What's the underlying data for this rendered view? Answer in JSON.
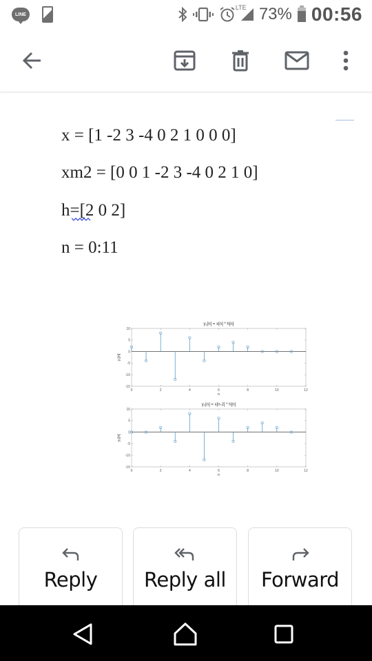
{
  "status_bar": {
    "left_icons": [
      "line-app-icon",
      "phone-screenshot-icon"
    ],
    "line_label": "LINE",
    "right_icons": [
      "bluetooth-icon",
      "vibrate-icon",
      "alarm-icon",
      "lte-signal-icon",
      "battery-icon"
    ],
    "network": "LTE",
    "battery_percent": "73%",
    "time": "00:56"
  },
  "toolbar": {
    "back_icon": "arrow-back-icon",
    "actions": [
      "archive-icon",
      "delete-icon",
      "mark-unread-icon",
      "more-vert-icon"
    ]
  },
  "message": {
    "lines": [
      "x = [1 -2 3 -4 0 2 1 0 0 0]",
      "xm2 = [0 0 1 -2 3 -4 0 2 1 0]",
      "h=[2 0 2]",
      "n = 0:11"
    ]
  },
  "chart_data": [
    {
      "type": "stem",
      "title": "y₁[n] = x[n] * h[n]",
      "xlabel": "n",
      "ylabel": "y₁[n]",
      "x": [
        0,
        1,
        2,
        3,
        4,
        5,
        6,
        7,
        8,
        9,
        10,
        11
      ],
      "values": [
        2,
        -4,
        8,
        -12,
        6,
        -4,
        2,
        4,
        2,
        0,
        0,
        0
      ],
      "xlim": [
        0,
        12
      ],
      "ylim": [
        -15,
        10
      ],
      "xticks": [
        "0",
        "2",
        "4",
        "6",
        "8",
        "10",
        "12"
      ],
      "yticks": [
        "10",
        "5",
        "0",
        "-5",
        "-10",
        "-15"
      ],
      "color": "#5b9bc8"
    },
    {
      "type": "stem",
      "title": "y₂[n] = x[n-2] * h[n]",
      "xlabel": "n",
      "ylabel": "y₂[n]",
      "x": [
        0,
        1,
        2,
        3,
        4,
        5,
        6,
        7,
        8,
        9,
        10,
        11
      ],
      "values": [
        0,
        0,
        2,
        -4,
        8,
        -12,
        6,
        -4,
        2,
        4,
        2,
        0
      ],
      "xlim": [
        0,
        12
      ],
      "ylim": [
        -15,
        10
      ],
      "xticks": [
        "0",
        "2",
        "4",
        "6",
        "8",
        "10",
        "12"
      ],
      "yticks": [
        "10",
        "5",
        "0",
        "-5",
        "-10",
        "-15"
      ],
      "color": "#5b9bc8"
    }
  ],
  "actions": {
    "reply_label": "Reply",
    "reply_all_label": "Reply all",
    "forward_label": "Forward"
  },
  "navbar": {
    "buttons": [
      "nav-back-icon",
      "nav-home-icon",
      "nav-recents-icon"
    ]
  }
}
